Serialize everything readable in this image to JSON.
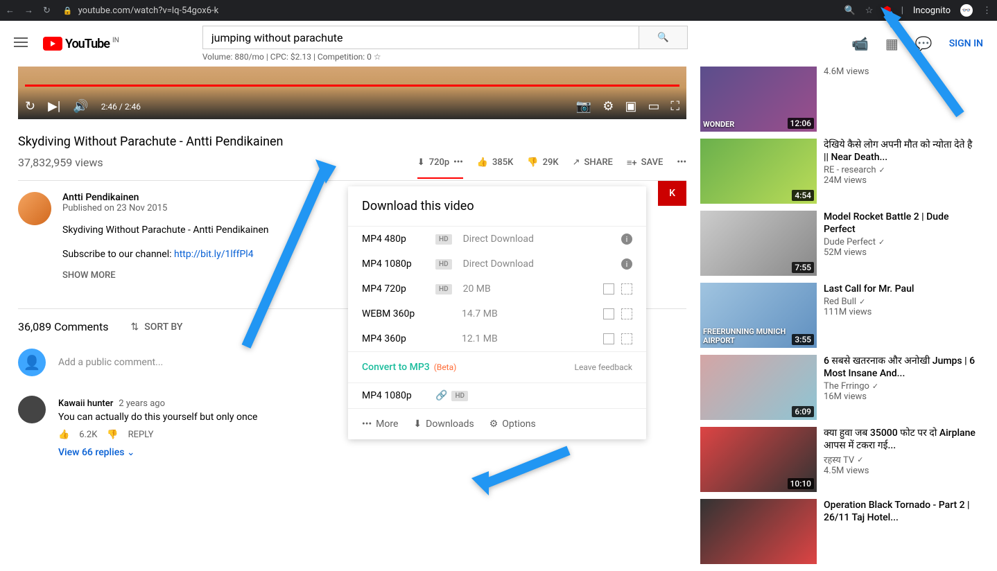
{
  "browser": {
    "url": "youtube.com/watch?v=lq-54gox6-k",
    "incognito": "Incognito"
  },
  "header": {
    "logo": "YouTube",
    "region": "IN",
    "search_value": "jumping without parachute",
    "search_stats": "Volume: 880/mo | CPC: $2.13 | Competition: 0",
    "signin": "SIGN IN"
  },
  "player": {
    "current": "2:46",
    "total": "2:46"
  },
  "video": {
    "title": "Skydiving Without Parachute - Antti Pendikainen",
    "views": "37,832,959 views",
    "download_quality": "720p",
    "likes": "385K",
    "dislikes": "29K",
    "share": "SHARE",
    "save": "SAVE"
  },
  "channel": {
    "name": "Antti Pendikainen",
    "published": "Published on 23 Nov 2015",
    "desc1": "Skydiving Without Parachute - Antti Pendikainen",
    "desc2_prefix": "Subscribe to our channel: ",
    "desc2_link": "http://bit.ly/1lffPl4",
    "show_more": "SHOW MORE",
    "subscribe": "K"
  },
  "comments": {
    "count": "36,089 Comments",
    "sort": "SORT BY",
    "placeholder": "Add a public comment...",
    "c1": {
      "author": "Kawaii hunter",
      "time": "2 years ago",
      "text": "You can actually do this yourself but only once",
      "likes": "6.2K",
      "reply": "REPLY",
      "replies": "View 66 replies"
    }
  },
  "suggestions": [
    {
      "title": "",
      "channel": "",
      "views": "4.6M views",
      "duration": "12:06",
      "overlay": "WONDER"
    },
    {
      "title": "देखिये कैसे लोग अपनी मौत को न्योता देते है || Near Death...",
      "channel": "RE - research",
      "views": "24M views",
      "duration": "4:54",
      "overlay": ""
    },
    {
      "title": "Model Rocket Battle 2 | Dude Perfect",
      "channel": "Dude Perfect",
      "views": "52M views",
      "duration": "7:55",
      "overlay": ""
    },
    {
      "title": "Last Call for Mr. Paul",
      "channel": "Red Bull",
      "views": "111M views",
      "duration": "3:55",
      "overlay": "FREERUNNING MUNICH AIRPORT"
    },
    {
      "title": "6 सबसे खतरनाक और अनोखी Jumps | 6 Most Insane And...",
      "channel": "The Frringo",
      "views": "16M views",
      "duration": "6:09",
      "overlay": ""
    },
    {
      "title": "क्या हुवा जब 35000 फोट पर दो Airplane आपस में टकरा गई...",
      "channel": "रहस्य TV",
      "views": "4.5M views",
      "duration": "10:10",
      "overlay": ""
    },
    {
      "title": "Operation Black Tornado - Part 2 | 26/11 Taj Hotel...",
      "channel": "",
      "views": "",
      "duration": "",
      "overlay": ""
    }
  ],
  "popup": {
    "title": "Download this video",
    "rows": [
      {
        "format": "MP4 480p",
        "hd": true,
        "label": "Direct Download",
        "info": true
      },
      {
        "format": "MP4 1080p",
        "hd": true,
        "label": "Direct Download",
        "info": true
      },
      {
        "format": "MP4 720p",
        "hd": true,
        "label": "20 MB",
        "copy": true
      },
      {
        "format": "WEBM 360p",
        "hd": false,
        "label": "14.7 MB",
        "copy": true
      },
      {
        "format": "MP4 360p",
        "hd": false,
        "label": "12.1 MB",
        "copy": true
      }
    ],
    "mp3": "Convert to MP3",
    "beta": "(Beta)",
    "feedback": "Leave feedback",
    "mp4_1080": "MP4 1080p",
    "footer_more": "More",
    "footer_downloads": "Downloads",
    "footer_options": "Options"
  }
}
